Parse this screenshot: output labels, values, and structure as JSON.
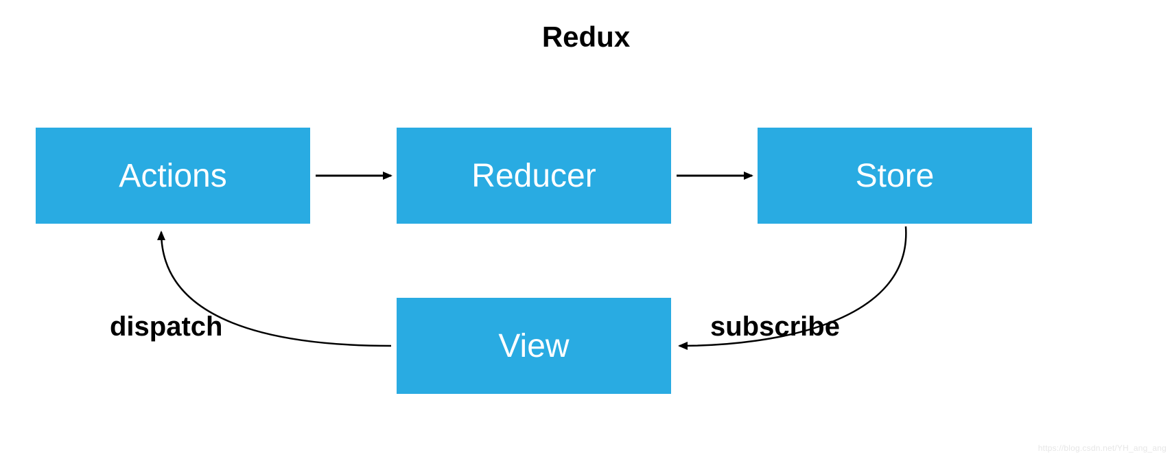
{
  "title": "Redux",
  "nodes": {
    "actions": "Actions",
    "reducer": "Reducer",
    "store": "Store",
    "view": "View"
  },
  "edges": {
    "dispatch_label": "dispatch",
    "subscribe_label": "subscribe"
  },
  "colors": {
    "box_bg": "#29abe2",
    "box_text": "#ffffff",
    "arrow": "#000000"
  },
  "watermark": "https://blog.csdn.net/YH_ang_ang"
}
